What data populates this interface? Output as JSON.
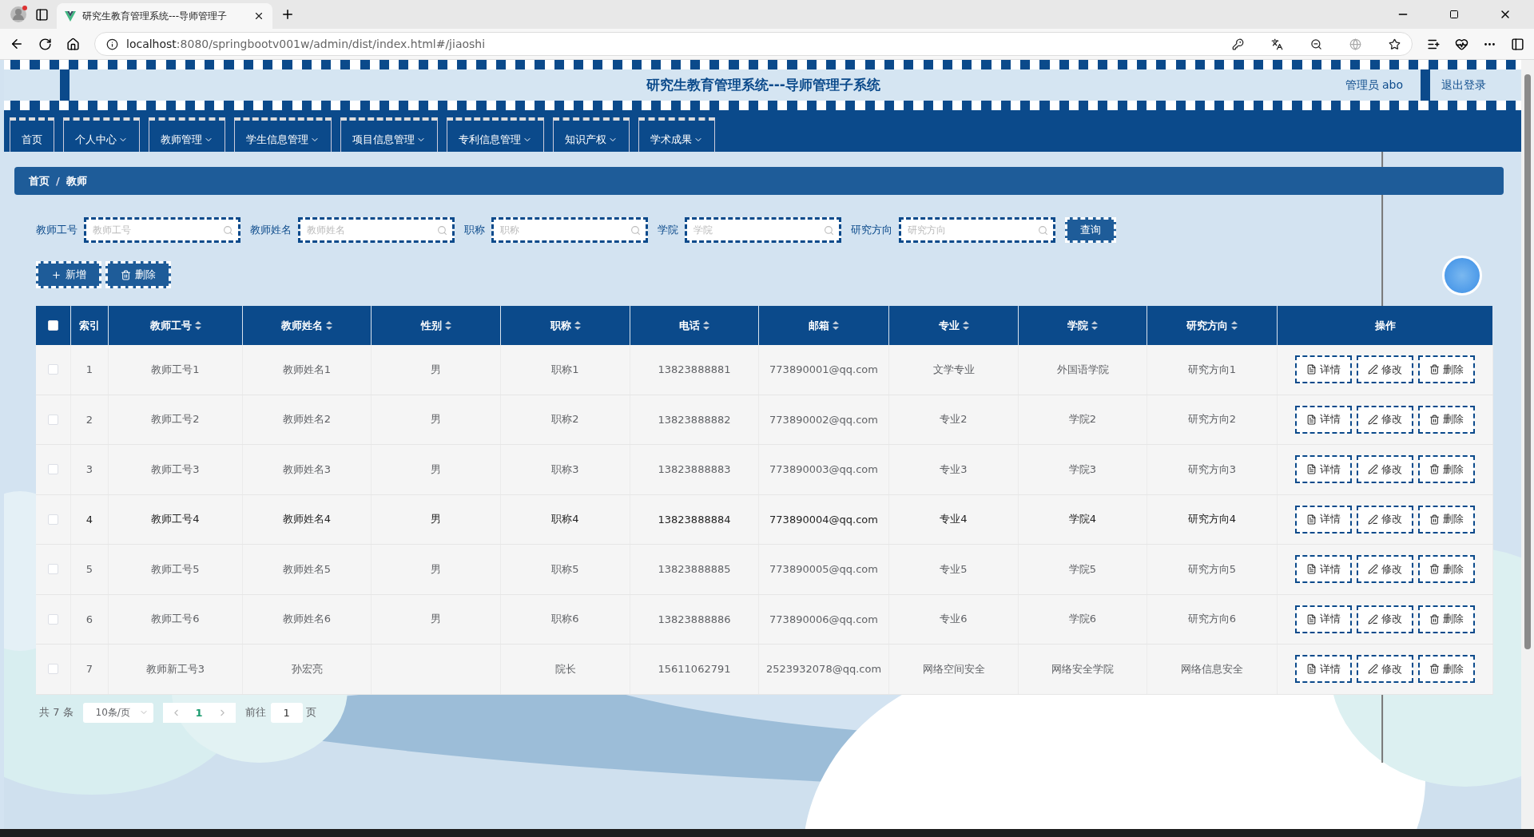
{
  "browser": {
    "tab_title": "研究生教育管理系统---导师管理子",
    "url_host": "localhost",
    "url_rest": ":8080/springbootv001w/admin/dist/index.html#/jiaoshi"
  },
  "header": {
    "title": "研究生教育管理系统---导师管理子系统",
    "user": "管理员 abo",
    "logout": "退出登录"
  },
  "nav": [
    {
      "label": "首页",
      "dropdown": false
    },
    {
      "label": "个人中心",
      "dropdown": true
    },
    {
      "label": "教师管理",
      "dropdown": true
    },
    {
      "label": "学生信息管理",
      "dropdown": true
    },
    {
      "label": "项目信息管理",
      "dropdown": true
    },
    {
      "label": "专利信息管理",
      "dropdown": true
    },
    {
      "label": "知识产权",
      "dropdown": true
    },
    {
      "label": "学术成果",
      "dropdown": true
    }
  ],
  "breadcrumb": {
    "items": [
      "首页",
      "教师"
    ],
    "separator": "/"
  },
  "filters": [
    {
      "label": "教师工号",
      "placeholder": "教师工号"
    },
    {
      "label": "教师姓名",
      "placeholder": "教师姓名"
    },
    {
      "label": "职称",
      "placeholder": "职称"
    },
    {
      "label": "学院",
      "placeholder": "学院"
    },
    {
      "label": "研究方向",
      "placeholder": "研究方向"
    }
  ],
  "search_button": "查询",
  "toolbar": [
    {
      "kind": "add",
      "label": "新增"
    },
    {
      "kind": "delete",
      "label": "删除"
    }
  ],
  "table": {
    "header_checked": false,
    "columns": [
      {
        "label": "索引",
        "sortable": false
      },
      {
        "label": "教师工号",
        "sortable": true
      },
      {
        "label": "教师姓名",
        "sortable": true
      },
      {
        "label": "性别",
        "sortable": true
      },
      {
        "label": "职称",
        "sortable": true
      },
      {
        "label": "电话",
        "sortable": true
      },
      {
        "label": "邮箱",
        "sortable": true
      },
      {
        "label": "专业",
        "sortable": true
      },
      {
        "label": "学院",
        "sortable": true
      },
      {
        "label": "研究方向",
        "sortable": true
      },
      {
        "label": "操作",
        "sortable": false
      }
    ],
    "rows": [
      {
        "checked": false,
        "highlighted": false,
        "actions": [
          "详情",
          "修改",
          "删除"
        ],
        "cells": [
          "1",
          "教师工号1",
          "教师姓名1",
          "男",
          "职称1",
          "13823888881",
          "773890001@qq.com",
          "文学专业",
          "外国语学院",
          "研究方向1"
        ]
      },
      {
        "checked": false,
        "highlighted": false,
        "actions": [
          "详情",
          "修改",
          "删除"
        ],
        "cells": [
          "2",
          "教师工号2",
          "教师姓名2",
          "男",
          "职称2",
          "13823888882",
          "773890002@qq.com",
          "专业2",
          "学院2",
          "研究方向2"
        ]
      },
      {
        "checked": false,
        "highlighted": false,
        "actions": [
          "详情",
          "修改",
          "删除"
        ],
        "cells": [
          "3",
          "教师工号3",
          "教师姓名3",
          "男",
          "职称3",
          "13823888883",
          "773890003@qq.com",
          "专业3",
          "学院3",
          "研究方向3"
        ]
      },
      {
        "checked": false,
        "highlighted": true,
        "actions": [
          "详情",
          "修改",
          "删除"
        ],
        "cells": [
          "4",
          "教师工号4",
          "教师姓名4",
          "男",
          "职称4",
          "13823888884",
          "773890004@qq.com",
          "专业4",
          "学院4",
          "研究方向4"
        ]
      },
      {
        "checked": false,
        "highlighted": false,
        "actions": [
          "详情",
          "修改",
          "删除"
        ],
        "cells": [
          "5",
          "教师工号5",
          "教师姓名5",
          "男",
          "职称5",
          "13823888885",
          "773890005@qq.com",
          "专业5",
          "学院5",
          "研究方向5"
        ]
      },
      {
        "checked": false,
        "highlighted": false,
        "actions": [
          "详情",
          "修改",
          "删除"
        ],
        "cells": [
          "6",
          "教师工号6",
          "教师姓名6",
          "男",
          "职称6",
          "13823888886",
          "773890006@qq.com",
          "专业6",
          "学院6",
          "研究方向6"
        ]
      },
      {
        "checked": false,
        "highlighted": false,
        "actions": [
          "详情",
          "修改",
          "删除"
        ],
        "cells": [
          "7",
          "教师新工号3",
          "孙宏亮",
          "",
          "院长",
          "15611062791",
          "2523932078@qq.com",
          "网络空间安全",
          "网络安全学院",
          "网络信息安全"
        ]
      }
    ]
  },
  "pagination": {
    "total": "共 7 条",
    "page_size": "10条/页",
    "pages": [
      {
        "label": "1",
        "selected": true
      }
    ],
    "goto_label": "前往",
    "goto_value": "1",
    "goto_suffix": "页"
  }
}
